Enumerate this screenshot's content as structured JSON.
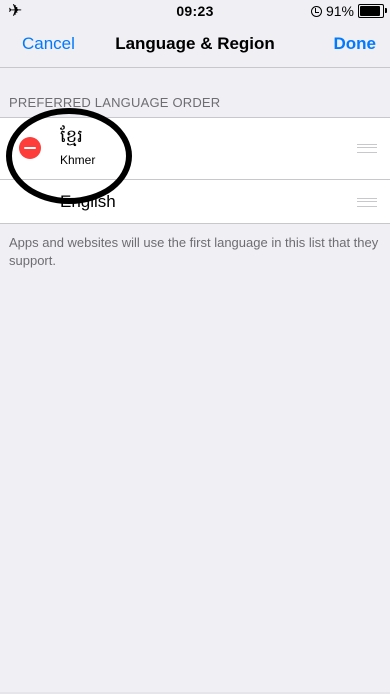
{
  "status_bar": {
    "airplane_icon": "airplane-icon",
    "time": "09:23",
    "battery_percent": "91%",
    "battery_level": 0.91
  },
  "nav": {
    "cancel_label": "Cancel",
    "title": "Language & Region",
    "done_label": "Done"
  },
  "section": {
    "header": "PREFERRED LANGUAGE ORDER"
  },
  "languages": [
    {
      "native": "ខ្មែរ",
      "name": "Khmer",
      "deletable": true
    },
    {
      "name": "English"
    }
  ],
  "footer_note": "Apps and websites will use the first language in this list that they support.",
  "colors": {
    "accent": "#007aff",
    "delete": "#fc3d39",
    "background": "#efeff4"
  }
}
